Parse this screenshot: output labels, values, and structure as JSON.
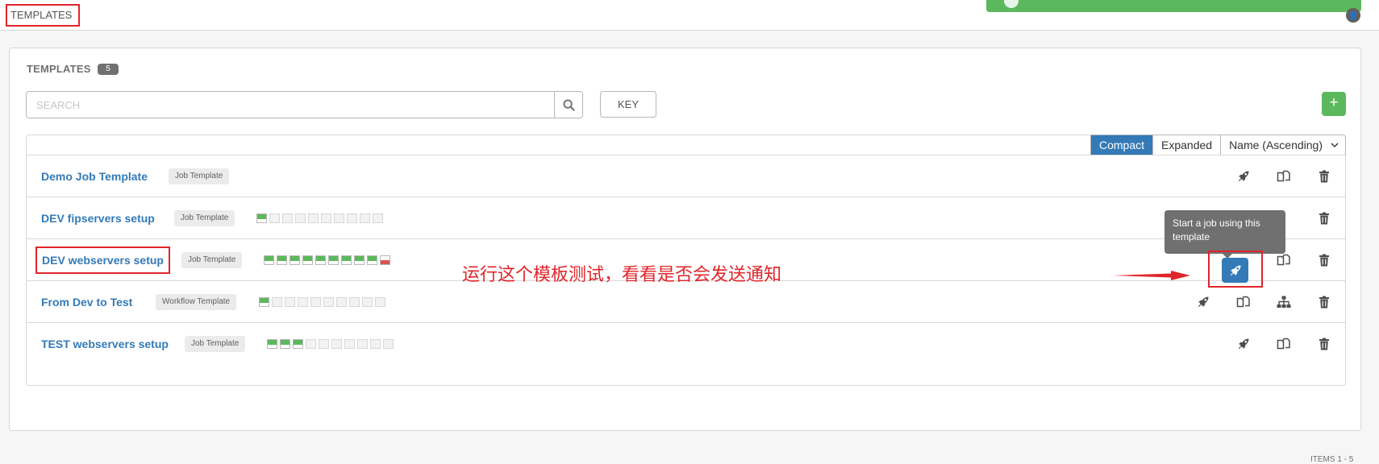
{
  "breadcrumb": {
    "title": "TEMPLATES"
  },
  "panel": {
    "title": "TEMPLATES",
    "count": "5"
  },
  "search": {
    "placeholder": "SEARCH",
    "value": ""
  },
  "key_button": "KEY",
  "add_button": "+",
  "toolbar": {
    "compact": "Compact",
    "expanded": "Expanded",
    "sort": "Name (Ascending)"
  },
  "rows": [
    {
      "name": "Demo Job Template",
      "type": "Job Template",
      "jobs": []
    },
    {
      "name": "DEV fipservers setup",
      "type": "Job Template",
      "jobs": [
        "success",
        "none",
        "none",
        "none",
        "none",
        "none",
        "none",
        "none",
        "none",
        "none"
      ]
    },
    {
      "name": "DEV webservers setup",
      "type": "Job Template",
      "jobs": [
        "success",
        "success",
        "success",
        "success",
        "success",
        "success",
        "success",
        "success",
        "success",
        "failed"
      ]
    },
    {
      "name": "From Dev to Test",
      "type": "Workflow Template",
      "jobs": [
        "success",
        "none",
        "none",
        "none",
        "none",
        "none",
        "none",
        "none",
        "none",
        "none"
      ]
    },
    {
      "name": "TEST webservers setup",
      "type": "Job Template",
      "jobs": [
        "success",
        "success",
        "success",
        "none",
        "none",
        "none",
        "none",
        "none",
        "none",
        "none"
      ]
    }
  ],
  "tooltip": "Start a job using this template",
  "annotation": "运行这个模板测试，看看是否会发送通知",
  "pagination": "ITEMS  1 - 5",
  "colors": {
    "primary": "#337ab7",
    "success": "#5cb85c",
    "failed": "#d9534f",
    "annotation": "#e0252b"
  },
  "icons": {
    "launch": "rocket-icon",
    "copy": "copy-icon",
    "delete": "trash-icon",
    "workflow": "sitemap-icon",
    "search": "search-icon"
  }
}
